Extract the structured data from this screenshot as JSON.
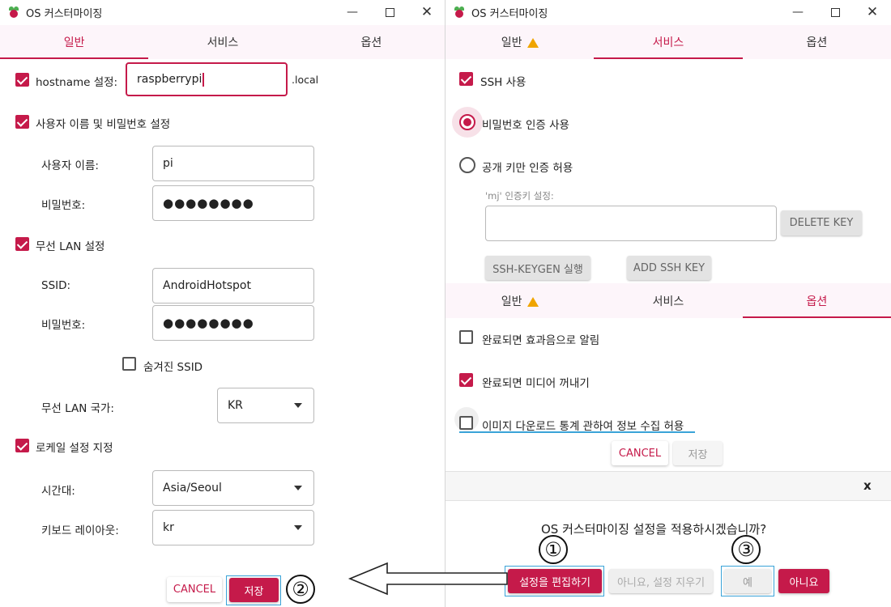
{
  "left_window": {
    "title": "OS 커스터마이징",
    "tabs": [
      "일반",
      "서비스",
      "옵션"
    ],
    "hostname": {
      "label": "hostname 설정:",
      "value": "raspberrypi",
      "suffix": ".local"
    },
    "user_section": {
      "label": "사용자 이름 및 비밀번호 설정",
      "username_label": "사용자 이름:",
      "username_value": "pi",
      "password_label": "비밀번호:",
      "password_value": "●●●●●●●●"
    },
    "wifi_section": {
      "label": "무선 LAN 설정",
      "ssid_label": "SSID:",
      "ssid_value": "AndroidHotspot",
      "password_label": "비밀번호:",
      "password_value": "●●●●●●●●",
      "hidden_label": "숨겨진 SSID",
      "country_label": "무선 LAN 국가:",
      "country_value": "KR"
    },
    "locale_section": {
      "label": "로케일 설정 지정",
      "timezone_label": "시간대:",
      "timezone_value": "Asia/Seoul",
      "keyboard_label": "키보드 레이아웃:",
      "keyboard_value": "kr"
    },
    "cancel_label": "CANCEL",
    "save_label": "저장"
  },
  "right_window": {
    "title": "OS 커스터마이징",
    "tabs": [
      "일반",
      "서비스",
      "옵션"
    ],
    "services": {
      "ssh_label": "SSH 사용",
      "password_auth_label": "비밀번호 인증 사용",
      "pubkey_only_label": "공개 키만 인증 허용",
      "authkey_label": "'mj' 인증키 설정:",
      "delete_key_label": "DELETE KEY",
      "keygen_label": "SSH-KEYGEN 실행",
      "add_key_label": "ADD SSH KEY"
    },
    "options_tabs": [
      "일반",
      "서비스",
      "옵션"
    ],
    "options": {
      "beep_label": "완료되면 효과음으로 알림",
      "eject_label": "완료되면 미디어 꺼내기",
      "telemetry_label": "이미지 다운로드 통계 관하여 정보 수집 허용"
    },
    "cancel_label": "CANCEL",
    "save_label": "저장",
    "dialog": {
      "close_label": "x",
      "question": "OS 커스터마이징 설정을 적용하시겠습니까?",
      "edit_label": "설정을 편집하기",
      "no_clear_label": "아니요, 설정 지우기",
      "yes_label": "예",
      "no_label": "아니요"
    }
  },
  "annotations": {
    "step1": "①",
    "step2": "②",
    "step3": "③"
  },
  "colors": {
    "accent": "#c51a4a",
    "highlight": "#3aa3d8",
    "tab_bg": "#fdf5fa"
  }
}
